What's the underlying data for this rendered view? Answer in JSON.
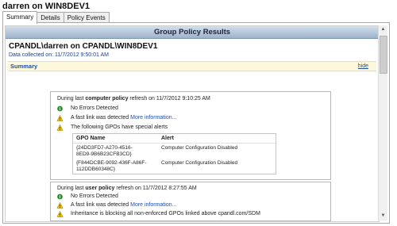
{
  "window": {
    "title": "darren on WIN8DEV1"
  },
  "tabs": [
    "Summary",
    "Details",
    "Policy Events"
  ],
  "report": {
    "header": "Group Policy Results",
    "title": "CPANDL\\darren on CPANDL\\WIN8DEV1",
    "collected": "Data collected on: 11/7/2012 9:50:01 AM",
    "summary_label": "Summary",
    "hide_label": "hide"
  },
  "computer": {
    "prefix": "During last ",
    "bold": "computer policy",
    "suffix": " refresh on 11/7/2012 9:10:25 AM",
    "no_errors": "No Errors Detected",
    "fastlink": "A fast link was detected",
    "more_info": "More information...",
    "gpo_alerts": "The following GPOs have special alerts",
    "table": {
      "col_gpo": "GPO Name",
      "col_alert": "Alert",
      "rows": [
        {
          "gpo1": "{24DD3FD7-A270-4516-",
          "gpo2": "8ED9-9B6B23CFB3CD}",
          "alert": "Computer Configuration Disabled"
        },
        {
          "gpo1": "{F844DCBE-9092-436F-A86F-",
          "gpo2": "112DDB60348C}",
          "alert": "Computer Configuration Disabled"
        }
      ]
    }
  },
  "user": {
    "prefix": "During last ",
    "bold": "user policy",
    "suffix": " refresh on 11/7/2012 8:27:55 AM",
    "no_errors": "No Errors Detected",
    "fastlink": "A fast link was detected",
    "more_info": "More information...",
    "inheritance": "Inheritance is blocking all non-enforced GPOs linked above cpandl.com/SDM"
  },
  "colors": {
    "info": "#2e8b2e",
    "warning": "#f5c400",
    "header": "#9db3ca",
    "link": "#1f4fa3"
  },
  "icons": {
    "info": "check-info-icon",
    "warning": "warning-icon"
  }
}
